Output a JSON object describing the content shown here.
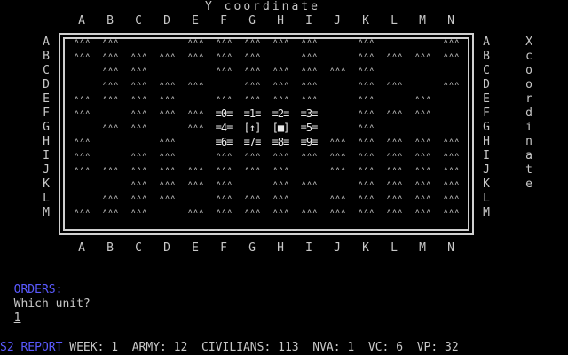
{
  "map": {
    "y_axis_title": "Y coordinate",
    "x_axis_title_letters": [
      "X",
      "c",
      "o",
      "o",
      "r",
      "d",
      "i",
      "n",
      "a",
      "t",
      "e"
    ],
    "columns": [
      "A",
      "B",
      "C",
      "D",
      "E",
      "F",
      "G",
      "H",
      "I",
      "J",
      "K",
      "L",
      "M",
      "N"
    ],
    "rows": [
      "A",
      "B",
      "C",
      "D",
      "E",
      "F",
      "G",
      "H",
      "I",
      "J",
      "K",
      "L",
      "M"
    ],
    "terrain_glyph": "ᶺᶺᶺ",
    "grid": [
      [
        "T",
        "T",
        "",
        "",
        "T",
        "T",
        "T",
        "T",
        "T",
        "",
        "T",
        "",
        "",
        "T"
      ],
      [
        "T",
        "T",
        "T",
        "T",
        "T",
        "T",
        "T",
        "",
        "T",
        "",
        "T",
        "T",
        "T",
        "T"
      ],
      [
        "",
        "T",
        "T",
        "",
        "",
        "T",
        "T",
        "T",
        "T",
        "T",
        "T",
        "",
        "",
        ""
      ],
      [
        "",
        "T",
        "T",
        "T",
        "T",
        "",
        "T",
        "T",
        "T",
        "",
        "T",
        "T",
        "",
        "T"
      ],
      [
        "T",
        "T",
        "T",
        "T",
        "",
        "T",
        "T",
        "T",
        "T",
        "",
        "T",
        "",
        "T",
        ""
      ],
      [
        "T",
        "",
        "T",
        "T",
        "T",
        "≡0≡",
        "≡1≡",
        "≡2≡",
        "≡3≡",
        "",
        "T",
        "T",
        "T",
        ""
      ],
      [
        "",
        "T",
        "T",
        "",
        "T",
        "≡4≡",
        "[↕]",
        "[■]",
        "≡5≡",
        "",
        "T",
        "",
        "",
        ""
      ],
      [
        "T",
        "",
        "",
        "T",
        "",
        "≡6≡",
        "≡7≡",
        "≡8≡",
        "≡9≡",
        "T",
        "T",
        "T",
        "T",
        "T"
      ],
      [
        "T",
        "",
        "T",
        "T",
        "",
        "T",
        "T",
        "T",
        "T",
        "T",
        "T",
        "T",
        "T",
        "T"
      ],
      [
        "T",
        "T",
        "T",
        "T",
        "T",
        "T",
        "T",
        "T",
        "",
        "T",
        "T",
        "T",
        "T",
        "T"
      ],
      [
        "",
        "",
        "T",
        "T",
        "T",
        "T",
        "",
        "T",
        "T",
        "",
        "T",
        "T",
        "T",
        "T"
      ],
      [
        "",
        "T",
        "T",
        "T",
        "",
        "T",
        "T",
        "T",
        "",
        "T",
        "T",
        "T",
        "T",
        "T"
      ],
      [
        "T",
        "T",
        "T",
        "",
        "T",
        "T",
        "T",
        "T",
        "T",
        "T",
        "T",
        "T",
        "T",
        "T"
      ]
    ]
  },
  "orders": {
    "label": "ORDERS:",
    "prompt": "Which unit?",
    "input_value": "1"
  },
  "status": {
    "label": "S2 REPORT",
    "week_label": "WEEK:",
    "week": "1",
    "army_label": "ARMY:",
    "army": "12",
    "civilians_label": "CIVILIANS:",
    "civilians": "113",
    "nva_label": "NVA:",
    "nva": "1",
    "vc_label": "VC:",
    "vc": "6",
    "vp_label": "VP:",
    "vp": "32"
  },
  "colors": {
    "background": "#000000",
    "text": "#c8c8c8",
    "accent": "#5a5aff"
  }
}
